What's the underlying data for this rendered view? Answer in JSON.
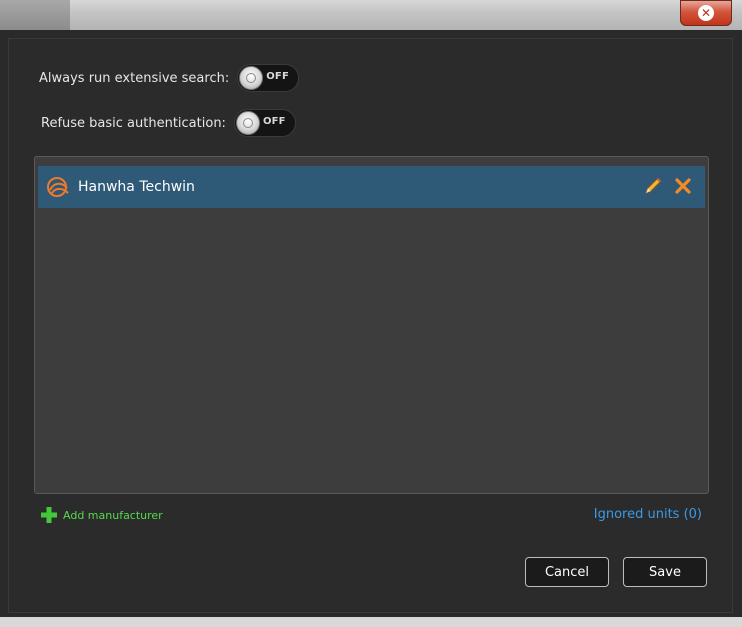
{
  "window": {
    "close_icon": "close-icon"
  },
  "settings": {
    "extensive_search": {
      "label": "Always run extensive search:",
      "state": "OFF"
    },
    "basic_auth": {
      "label": "Refuse basic authentication:",
      "state": "OFF"
    }
  },
  "manufacturers": {
    "items": [
      {
        "name": "Hanwha Techwin",
        "icon": "hanwha-logo-icon"
      }
    ]
  },
  "actions": {
    "add_manufacturer_label": "Add manufacturer",
    "ignored_units_label": "Ignored units (0)",
    "cancel_label": "Cancel",
    "save_label": "Save"
  },
  "colors": {
    "selected_row": "#2f5a77",
    "add_link": "#55d94e",
    "ignored_link": "#3a9ae8",
    "close_button": "#c0341b"
  }
}
